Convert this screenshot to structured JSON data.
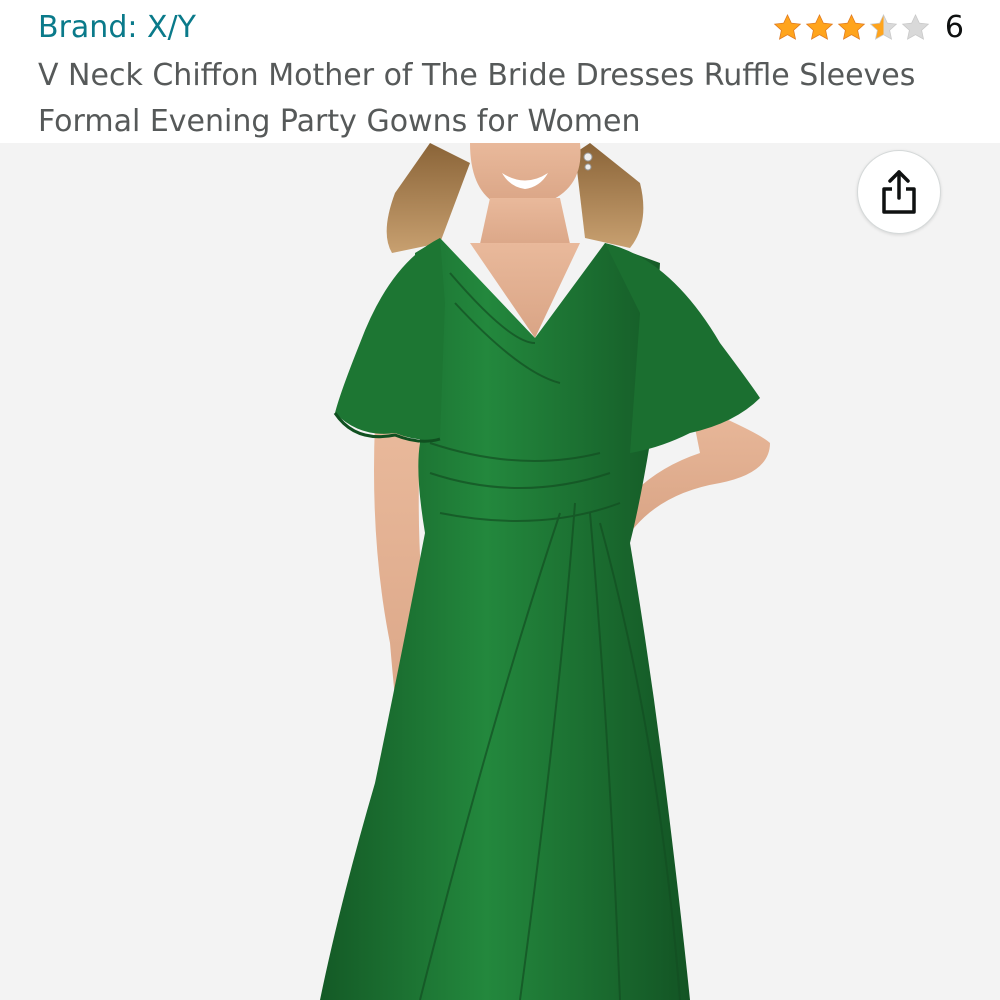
{
  "product": {
    "brand_label": "Brand: X/Y",
    "title": "V Neck Chiffon Mother of The Bride Dresses Ruffle Sleeves Formal Evening Party Gowns for Women",
    "rating": {
      "stars": 3.5,
      "max_stars": 5,
      "count": "6"
    }
  },
  "image": {
    "alt": "Model wearing green V-neck chiffon dress with ruffle sleeves",
    "dress_color": "#1f7a36"
  },
  "actions": {
    "share_icon": "share-icon"
  },
  "colors": {
    "brand_link": "#0a7a8a",
    "title_text": "#565959",
    "star_filled": "#ffa41c",
    "star_empty": "#d9d9d9",
    "image_bg": "#f3f3f3"
  }
}
